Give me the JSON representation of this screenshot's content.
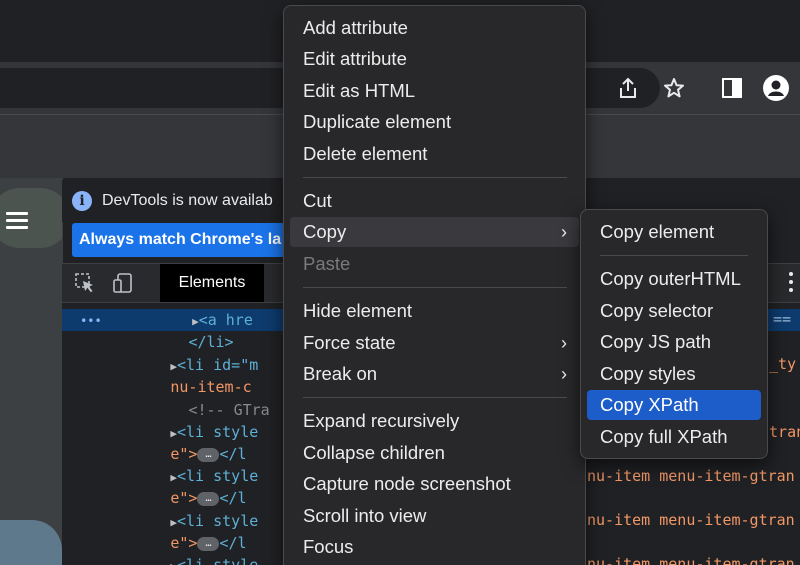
{
  "browser": {
    "icons": [
      "share-icon",
      "star-icon",
      "sidepanel-icon",
      "profile-icon"
    ]
  },
  "devtools": {
    "info_text": "DevTools is now availab",
    "match_button": "Always match Chrome's la",
    "elements_tab": "Elements",
    "code_lines": {
      "l1_tag": "<a hre",
      "l2": "</li>",
      "l3_tag": "<li id=\"m",
      "l4": "nu-item-c",
      "l5": "<!-- GTra",
      "l6_tag": "<li style",
      "l7_open": "e\">",
      "l7_close": "</l",
      "ellipsis": "…"
    },
    "right_code": {
      "r1": "==",
      "r3": "_ty",
      "r6": "gtran",
      "r8": "nu-item menu-item-gtran",
      "r10": "nu-item menu-item-gtran",
      "r12": "nu-item menu-item-gtran"
    },
    "selected_line_marker": "•••"
  },
  "context_menu": {
    "items": [
      {
        "label": "Add attribute"
      },
      {
        "label": "Edit attribute"
      },
      {
        "label": "Edit as HTML"
      },
      {
        "label": "Duplicate element"
      },
      {
        "label": "Delete element"
      },
      {
        "label": "Cut"
      },
      {
        "label": "Copy",
        "submenu": true,
        "highlighted": true
      },
      {
        "label": "Paste",
        "disabled": true
      },
      {
        "label": "Hide element"
      },
      {
        "label": "Force state",
        "submenu": true
      },
      {
        "label": "Break on",
        "submenu": true
      },
      {
        "label": "Expand recursively"
      },
      {
        "label": "Collapse children"
      },
      {
        "label": "Capture node screenshot"
      },
      {
        "label": "Scroll into view"
      },
      {
        "label": "Focus"
      }
    ],
    "chevron": "›"
  },
  "copy_submenu": {
    "items": [
      {
        "label": "Copy element"
      },
      {
        "label": "Copy outerHTML"
      },
      {
        "label": "Copy selector"
      },
      {
        "label": "Copy JS path"
      },
      {
        "label": "Copy styles"
      },
      {
        "label": "Copy XPath",
        "active": true
      },
      {
        "label": "Copy full XPath"
      }
    ]
  },
  "colors": {
    "menu_bg": "#28282a",
    "active_item": "#1c5dc9",
    "info_accent": "#8ab4f8",
    "match_button_bg": "#1a73e8"
  }
}
